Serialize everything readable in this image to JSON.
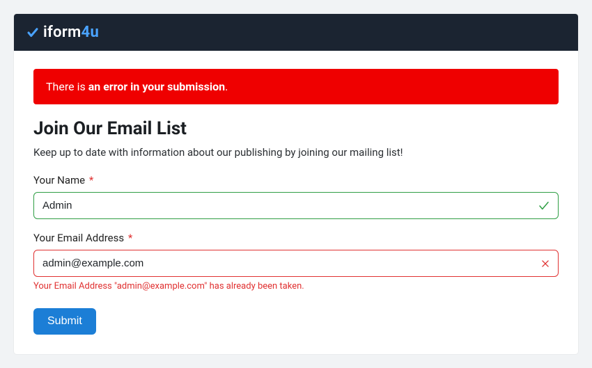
{
  "header": {
    "logo_text_main": "iform",
    "logo_text_accent": "4u"
  },
  "alert": {
    "prefix": "There is ",
    "bold": "an error in your submission",
    "suffix": "."
  },
  "page": {
    "title": "Join Our Email List",
    "subtitle": "Keep up to date with information about our publishing by joining our mailing list!"
  },
  "form": {
    "name": {
      "label": "Your Name",
      "required": "*",
      "value": "Admin",
      "state": "valid"
    },
    "email": {
      "label": "Your Email Address",
      "required": "*",
      "value": "admin@example.com",
      "state": "invalid",
      "error": "Your Email Address \"admin@example.com\" has already been taken."
    },
    "submit_label": "Submit"
  },
  "colors": {
    "alert_bg": "#ef0000",
    "primary_button": "#1c7ed6",
    "valid_border": "#2f9e44",
    "invalid_border": "#e03131",
    "header_bg": "#1b2431"
  }
}
